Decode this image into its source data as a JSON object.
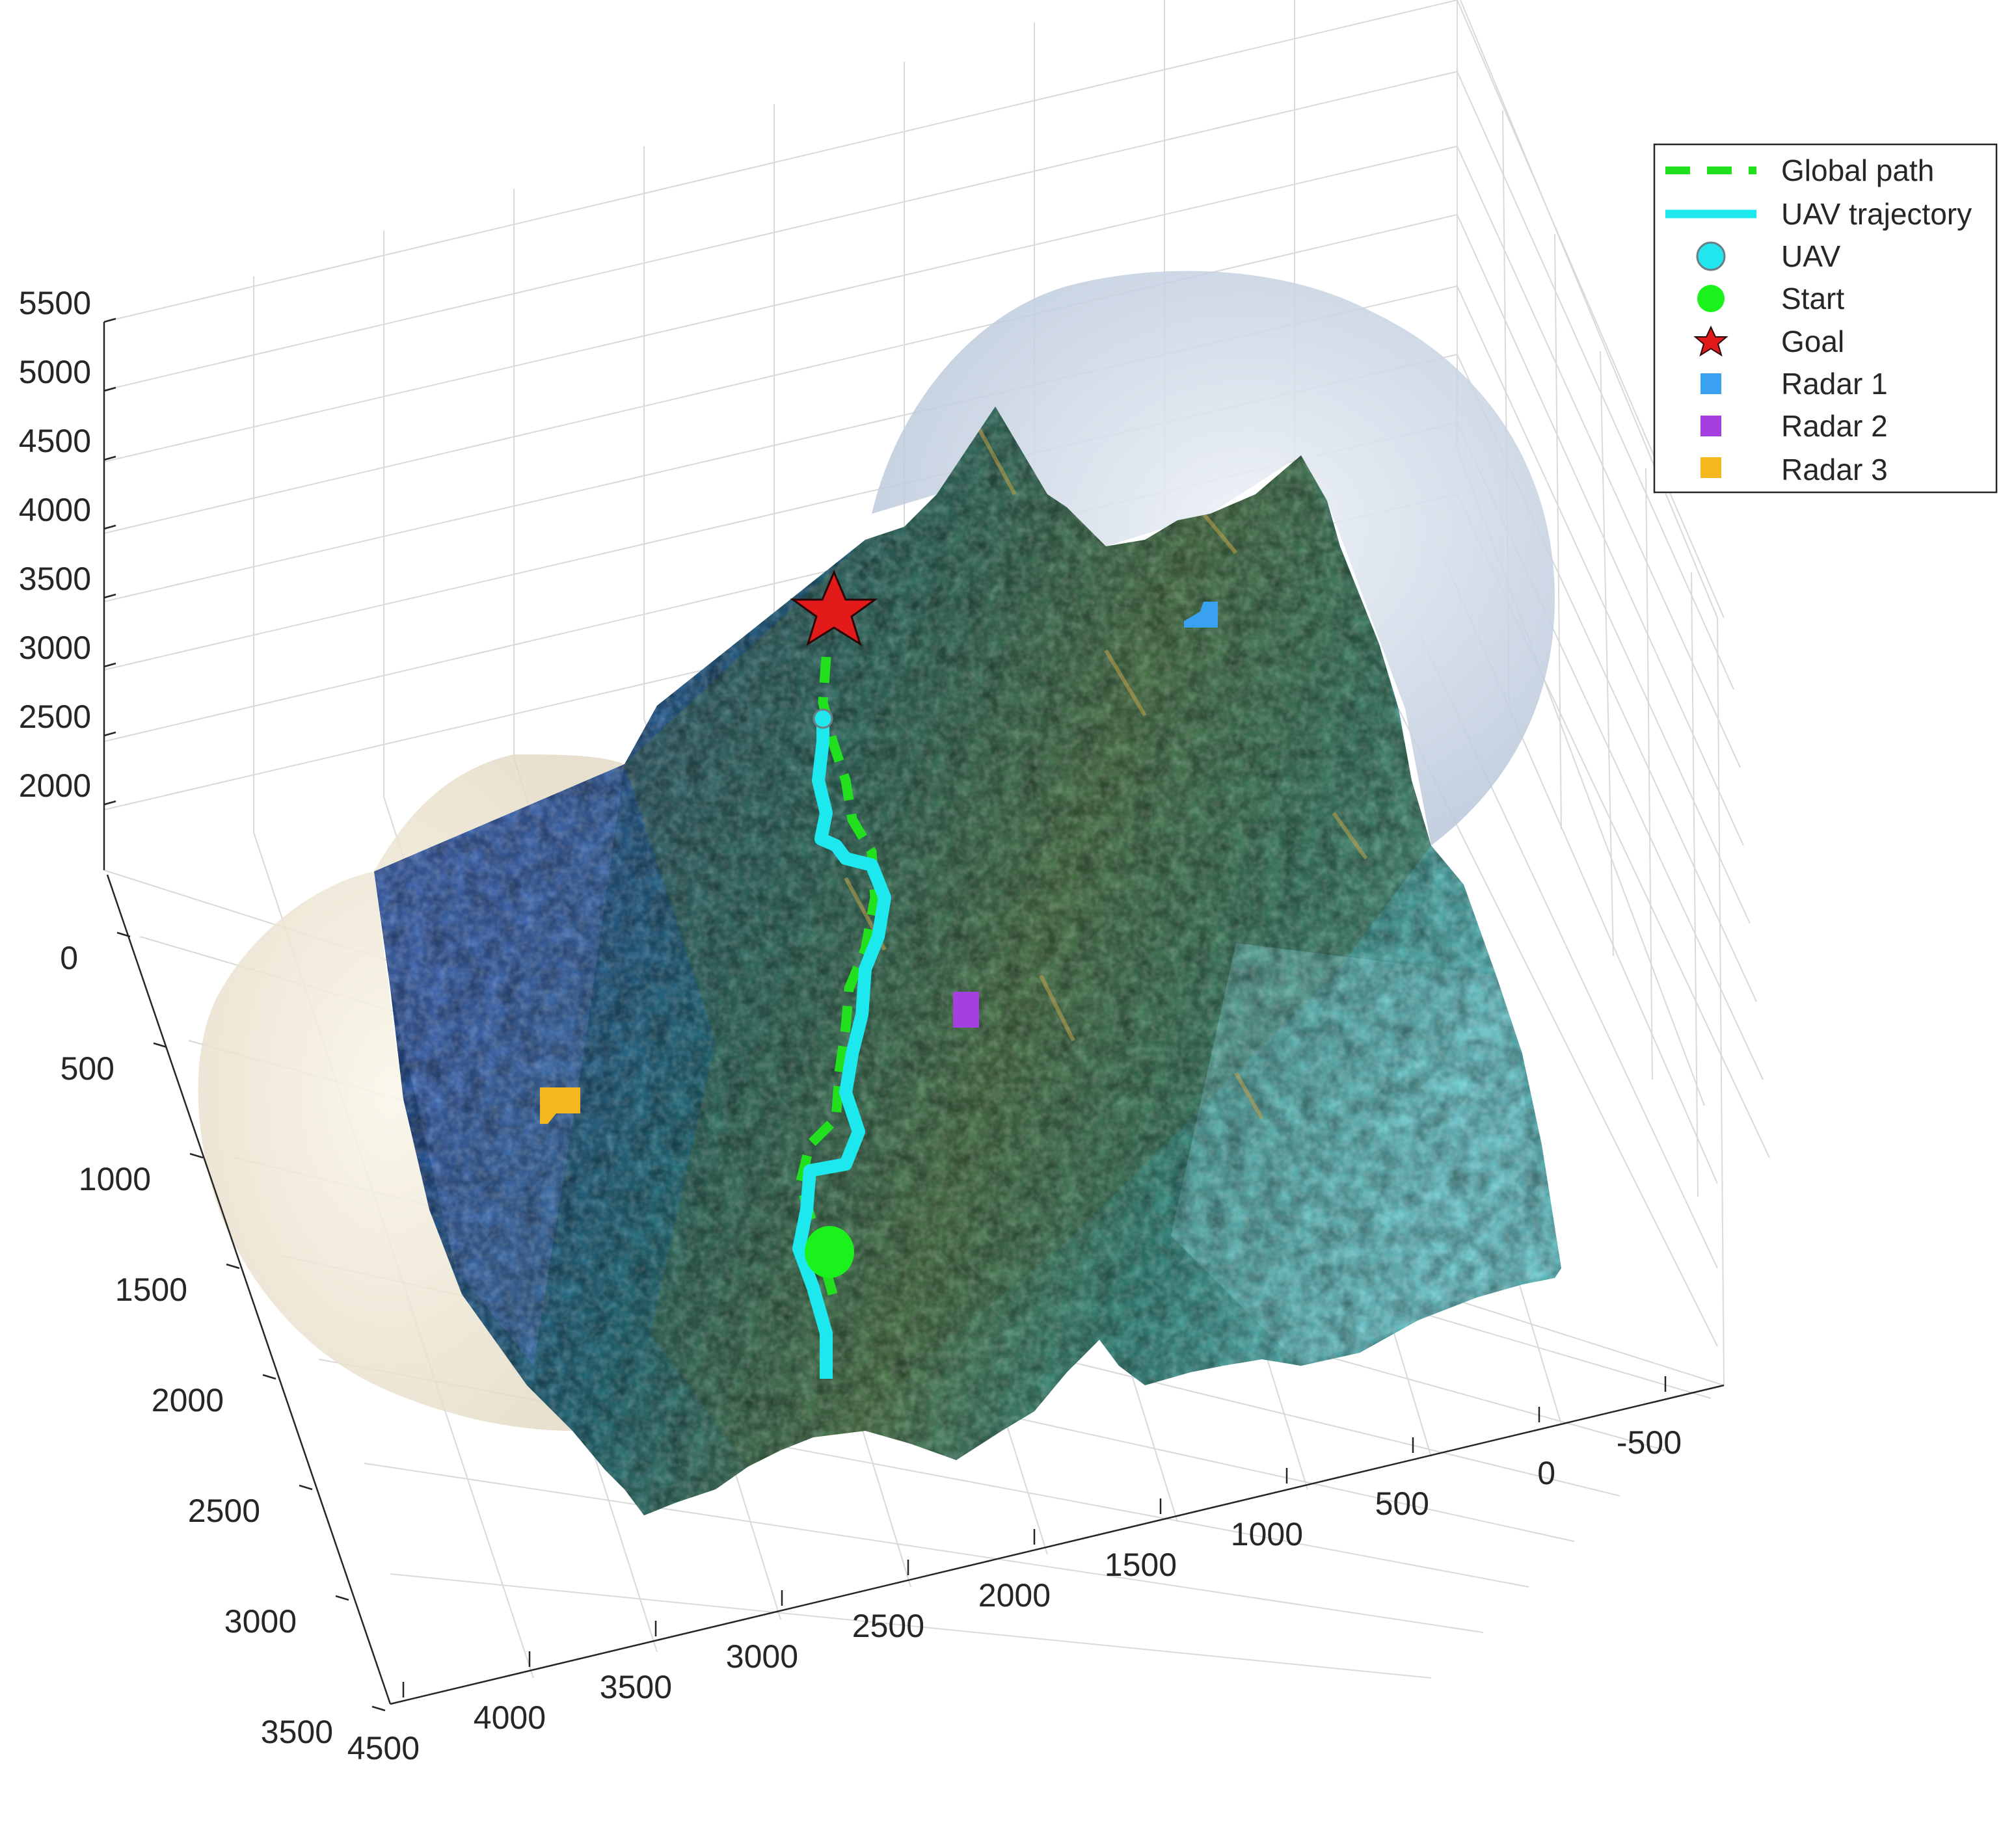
{
  "chart_data": {
    "type": "surface3d",
    "axes": {
      "z_ticks": [
        "5500",
        "5000",
        "4500",
        "4000",
        "3500",
        "3000",
        "2500",
        "2000"
      ],
      "y_ticks": [
        "0",
        "500",
        "1000",
        "1500",
        "2000",
        "2500",
        "3000",
        "3500"
      ],
      "x_ticks": [
        "4500",
        "4000",
        "3500",
        "3000",
        "2500",
        "2000",
        "1500",
        "1000",
        "500",
        "0",
        "-500"
      ]
    },
    "legend": {
      "position": "top-right",
      "entries": [
        {
          "label": "Global path",
          "color": "#22e01e",
          "marker": "dashed-line"
        },
        {
          "label": "UAV trajectory",
          "color": "#1de8ee",
          "marker": "line"
        },
        {
          "label": "UAV",
          "color": "#22e6ee",
          "marker": "circle"
        },
        {
          "label": "Start",
          "color": "#1bf21b",
          "marker": "circle"
        },
        {
          "label": "Goal",
          "color": "#e21a1a",
          "marker": "star"
        },
        {
          "label": "Radar 1",
          "color": "#3aa0f0",
          "marker": "square"
        },
        {
          "label": "Radar 2",
          "color": "#a63fe0",
          "marker": "square"
        },
        {
          "label": "Radar 3",
          "color": "#f5b71e",
          "marker": "square"
        }
      ]
    },
    "colors": {
      "terrain_low": "#3e64c6",
      "terrain_mid": "#2e8a8a",
      "terrain_high": "#9a8a40",
      "terrain_light": "#7de0e6",
      "radar_dome_1": "#b5c4d8",
      "radar_dome_3": "#e2d8c2"
    }
  }
}
